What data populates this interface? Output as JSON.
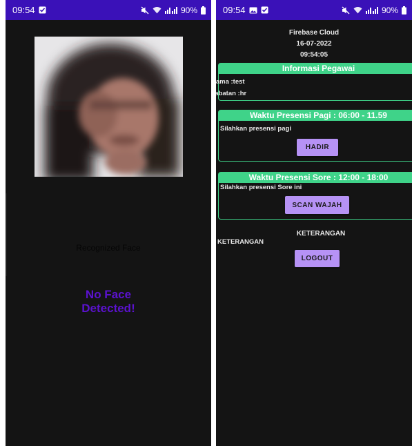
{
  "left_phone": {
    "status_bar": {
      "time": "09:54",
      "battery": "90%"
    },
    "photo": {
      "icon": "person-face-blurred"
    },
    "recognized_label": "Recognized Face",
    "no_face_text": "No Face\nDetected!"
  },
  "right_phone": {
    "status_bar": {
      "time": "09:54",
      "battery": "90%"
    },
    "header": {
      "title": "Firebase Cloud",
      "date": "16-07-2022",
      "time": "09:54:05"
    },
    "employee_info": {
      "title": "Informasi Pegawai",
      "name": "Nama :test",
      "position": "Jabatan :hr"
    },
    "morning": {
      "title": "Waktu Presensi Pagi : 06:00 - 11.59",
      "prompt": "Silahkan presensi pagi",
      "button": "HADIR"
    },
    "afternoon": {
      "title": "Waktu Presensi Sore : 12:00 - 18:00",
      "prompt": "Silahkan presensi Sore ini",
      "button": "SCAN WAJAH"
    },
    "keterangan_center": "KETERANGAN",
    "keterangan_left": "KETERANGAN",
    "logout_button": "LOGOUT"
  },
  "colors": {
    "status_bar": "#3a11b8",
    "background": "#141414",
    "accent_green": "#3fd389",
    "button_purple": "#b692f5",
    "no_face_purple": "#5b12cf"
  }
}
